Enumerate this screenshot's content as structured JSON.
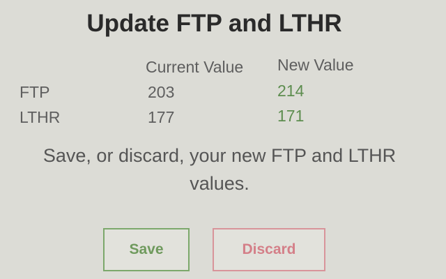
{
  "dialog": {
    "title": "Update FTP and LTHR",
    "columns": {
      "current": "Current Value",
      "new": "New Value"
    },
    "rows": [
      {
        "label": "FTP",
        "current": "203",
        "new": "214"
      },
      {
        "label": "LTHR",
        "current": "177",
        "new": "171"
      }
    ],
    "message": "Save, or discard, your new FTP and LTHR values.",
    "buttons": {
      "save": "Save",
      "discard": "Discard"
    }
  },
  "colors": {
    "background": "#dcdcd6",
    "new_value": "#5d8d4f",
    "save_accent": "#7ca86b",
    "discard_accent": "#d8949a"
  }
}
